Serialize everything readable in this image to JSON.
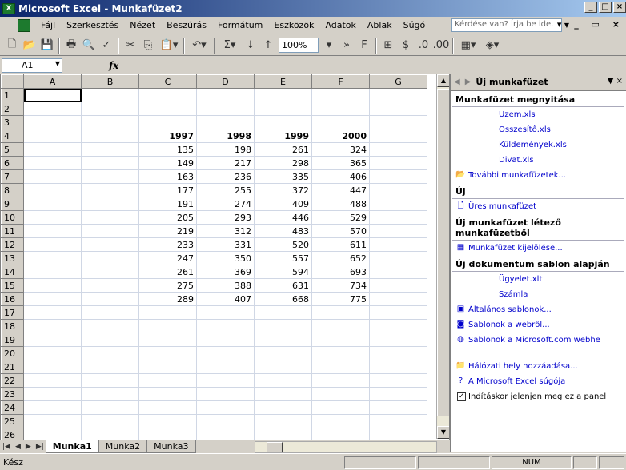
{
  "window": {
    "title": "Microsoft Excel - Munkafüzet2",
    "min": "_",
    "max": "□",
    "close": "×"
  },
  "menu": {
    "items": [
      "Fájl",
      "Szerkesztés",
      "Nézet",
      "Beszúrás",
      "Formátum",
      "Eszközök",
      "Adatok",
      "Ablak",
      "Súgó"
    ],
    "help_placeholder": "Kérdése van? Írja be ide.",
    "doc_controls": "▾ _ ▭ ×"
  },
  "toolbar": {
    "zoom": "100%"
  },
  "formula_bar": {
    "cell_ref": "A1",
    "fx": "fx"
  },
  "sheet": {
    "columns": [
      "A",
      "B",
      "C",
      "D",
      "E",
      "F",
      "G"
    ],
    "rows": [
      [
        "",
        "",
        "",
        "",
        "",
        "",
        ""
      ],
      [
        "",
        "",
        "",
        "",
        "",
        "",
        ""
      ],
      [
        "",
        "",
        "",
        "",
        "",
        "",
        ""
      ],
      [
        "",
        "",
        "1997",
        "1998",
        "1999",
        "2000",
        ""
      ],
      [
        "",
        "",
        "135",
        "198",
        "261",
        "324",
        ""
      ],
      [
        "",
        "",
        "149",
        "217",
        "298",
        "365",
        ""
      ],
      [
        "",
        "",
        "163",
        "236",
        "335",
        "406",
        ""
      ],
      [
        "",
        "",
        "177",
        "255",
        "372",
        "447",
        ""
      ],
      [
        "",
        "",
        "191",
        "274",
        "409",
        "488",
        ""
      ],
      [
        "",
        "",
        "205",
        "293",
        "446",
        "529",
        ""
      ],
      [
        "",
        "",
        "219",
        "312",
        "483",
        "570",
        ""
      ],
      [
        "",
        "",
        "233",
        "331",
        "520",
        "611",
        ""
      ],
      [
        "",
        "",
        "247",
        "350",
        "557",
        "652",
        ""
      ],
      [
        "",
        "",
        "261",
        "369",
        "594",
        "693",
        ""
      ],
      [
        "",
        "",
        "275",
        "388",
        "631",
        "734",
        ""
      ],
      [
        "",
        "",
        "289",
        "407",
        "668",
        "775",
        ""
      ],
      [
        "",
        "",
        "",
        "",
        "",
        "",
        ""
      ],
      [
        "",
        "",
        "",
        "",
        "",
        "",
        ""
      ],
      [
        "",
        "",
        "",
        "",
        "",
        "",
        ""
      ],
      [
        "",
        "",
        "",
        "",
        "",
        "",
        ""
      ],
      [
        "",
        "",
        "",
        "",
        "",
        "",
        ""
      ],
      [
        "",
        "",
        "",
        "",
        "",
        "",
        ""
      ],
      [
        "",
        "",
        "",
        "",
        "",
        "",
        ""
      ],
      [
        "",
        "",
        "",
        "",
        "",
        "",
        ""
      ],
      [
        "",
        "",
        "",
        "",
        "",
        "",
        ""
      ],
      [
        "",
        "",
        "",
        "",
        "",
        "",
        ""
      ]
    ],
    "tabs": [
      "Munka1",
      "Munka2",
      "Munka3"
    ],
    "active_tab": "Munka1"
  },
  "taskpane": {
    "title": "Új munkafüzet",
    "sections": [
      {
        "heading": "Munkafüzet megnyitása",
        "items": [
          {
            "label": "Üzem.xls",
            "icon": ""
          },
          {
            "label": "Összesítő.xls",
            "icon": ""
          },
          {
            "label": "Küldemények.xls",
            "icon": ""
          },
          {
            "label": "Divat.xls",
            "icon": ""
          },
          {
            "label": "További munkafüzetek...",
            "icon": "folder-icon"
          }
        ]
      },
      {
        "heading": "Új",
        "items": [
          {
            "label": "Üres munkafüzet",
            "icon": "blank-page-icon"
          }
        ]
      },
      {
        "heading": "Új munkafüzet létező munkafüzetből",
        "items": [
          {
            "label": "Munkafüzet kijelölése...",
            "icon": "workbook-icon"
          }
        ]
      },
      {
        "heading": "Új dokumentum sablon alapján",
        "items": [
          {
            "label": "Ügyelet.xlt",
            "icon": ""
          },
          {
            "label": "Számla",
            "icon": ""
          },
          {
            "label": "Általános sablonok...",
            "icon": "template-icon"
          },
          {
            "label": "Sablonok a webről...",
            "icon": "web-icon"
          },
          {
            "label": "Sablonok a Microsoft.com webhe",
            "icon": "globe-icon"
          }
        ]
      }
    ],
    "bottom_links": [
      {
        "label": "Hálózati hely hozzáadása...",
        "icon": "network-folder-icon"
      },
      {
        "label": "A Microsoft Excel súgója",
        "icon": "help-icon"
      }
    ],
    "startup_checkbox": "Indításkor jelenjen meg ez a panel"
  },
  "status": {
    "text": "Kész",
    "num": "NUM"
  }
}
